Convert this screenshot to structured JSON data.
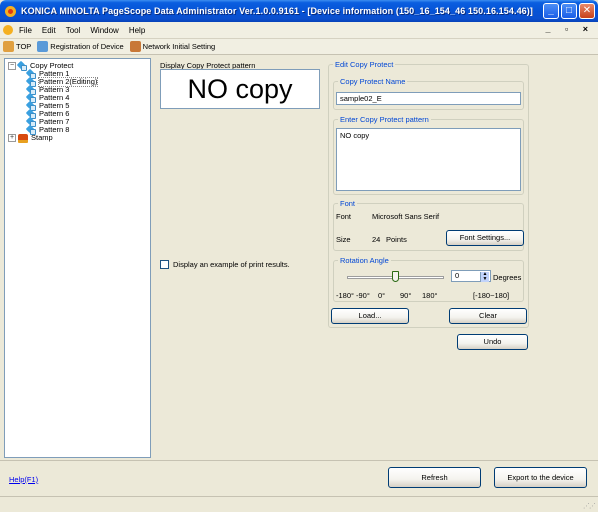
{
  "window": {
    "title": "KONICA MINOLTA PageScope Data Administrator Ver.1.0.0.9161 - [Device information (150_16_154_46 150.16.154.46)]",
    "minimize": "_",
    "maximize": "□",
    "close": "✕"
  },
  "menu": {
    "items": [
      {
        "label": "File"
      },
      {
        "label": "Edit"
      },
      {
        "label": "Tool"
      },
      {
        "label": "Window"
      },
      {
        "label": "Help"
      }
    ],
    "mdi_controls": "_ ▫ ×"
  },
  "toolbar": {
    "top": "TOP",
    "registration": "Registration of Device",
    "network": "Network Initial Setting"
  },
  "tree": {
    "copy_protect": "Copy Protect",
    "patterns": [
      "Pattern 1",
      "Pattern 2(Editing)",
      "Pattern 3",
      "Pattern 4",
      "Pattern 5",
      "Pattern 6",
      "Pattern 7",
      "Pattern 8"
    ],
    "stamp": "Stamp",
    "minus": "−",
    "plus": "+"
  },
  "display": {
    "label": "Display Copy Protect pattern",
    "preview_text": "NO copy",
    "example_label": "Display an example of print results."
  },
  "edit": {
    "group_title": "Edit Copy Protect",
    "name_group": "Copy Protect Name",
    "name_value": "sample02_E",
    "pattern_group": "Enter Copy Protect pattern",
    "pattern_value": "NO copy"
  },
  "font": {
    "group_title": "Font",
    "font_label": "Font",
    "font_value": "Microsoft Sans Serif",
    "size_label": "Size",
    "size_value": "24",
    "size_unit": "Points",
    "settings_button": "Font Settings..."
  },
  "rotation": {
    "group_title": "Rotation Angle",
    "value": "0",
    "unit": "Degrees",
    "ticks": [
      "-180°",
      "-90°",
      "0°",
      "90°",
      "180°"
    ],
    "range": "[-180~180]",
    "slider_fraction": 0.5
  },
  "buttons": {
    "load": "Load...",
    "clear": "Clear",
    "undo": "Undo",
    "refresh": "Refresh",
    "export": "Export to the device"
  },
  "footer": {
    "help": "Help(F1)"
  },
  "colors": {
    "title_blue": "#0653d6",
    "group_title_blue": "#0046d5",
    "link_blue": "#0000ee"
  }
}
